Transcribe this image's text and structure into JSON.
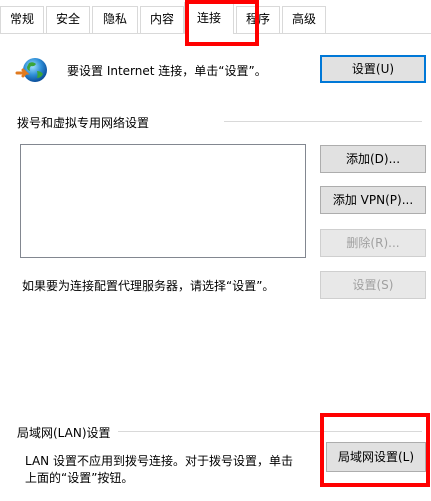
{
  "tabs": [
    {
      "id": "general",
      "label": "常规"
    },
    {
      "id": "security",
      "label": "安全"
    },
    {
      "id": "privacy",
      "label": "隐私"
    },
    {
      "id": "content",
      "label": "内容"
    },
    {
      "id": "connections",
      "label": "连接"
    },
    {
      "id": "programs",
      "label": "程序"
    },
    {
      "id": "advanced",
      "label": "高级"
    }
  ],
  "active_tab": "connections",
  "internet_setup": {
    "text": "要设置 Internet 连接，单击“设置”。",
    "button": "设置(U)"
  },
  "dialup_vpn": {
    "group_label": "拨号和虚拟专用网络设置",
    "add_button": "添加(D)...",
    "add_vpn_button": "添加 VPN(P)...",
    "remove_button": "删除(R)...",
    "proxy_text": "如果要为连接配置代理服务器，请选择“设置”。",
    "settings_button": "设置(S)"
  },
  "lan": {
    "group_label": "局域网(LAN)设置",
    "text_line1": "LAN 设置不应用到拨号连接。对于拨号设置，单击",
    "text_line2": "上面的“设置”按钮。",
    "button": "局域网设置(L)"
  },
  "highlight_color": "#ff0000"
}
